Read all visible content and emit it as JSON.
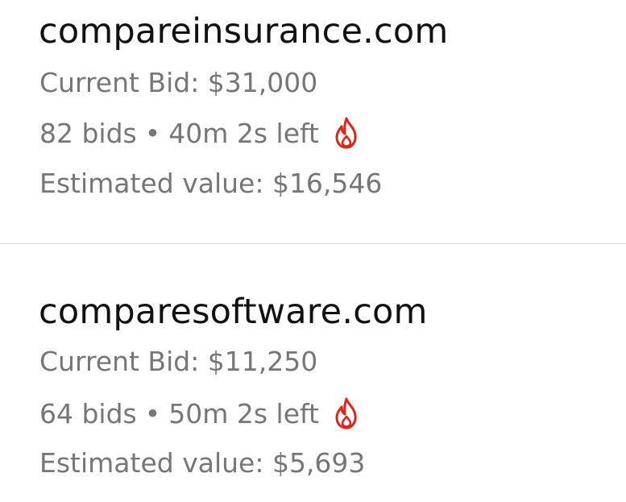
{
  "listings": [
    {
      "domain": "compareinsurance.com",
      "current_bid": "Current Bid: $31,000",
      "bids": "82 bids",
      "separator": "•",
      "time_left": "40m 2s left",
      "estimated_value": "Estimated value: $16,546",
      "icon": "fire-icon"
    },
    {
      "domain": "comparesoftware.com",
      "current_bid": "Current Bid: $11,250",
      "bids": "64 bids",
      "separator": "•",
      "time_left": "50m 2s left",
      "estimated_value": "Estimated value: $5,693",
      "icon": "fire-icon"
    }
  ],
  "colors": {
    "domain_text": "#111111",
    "secondary_text": "#767676",
    "fire_icon": "#e2231a",
    "divider": "#d9d9d9"
  }
}
